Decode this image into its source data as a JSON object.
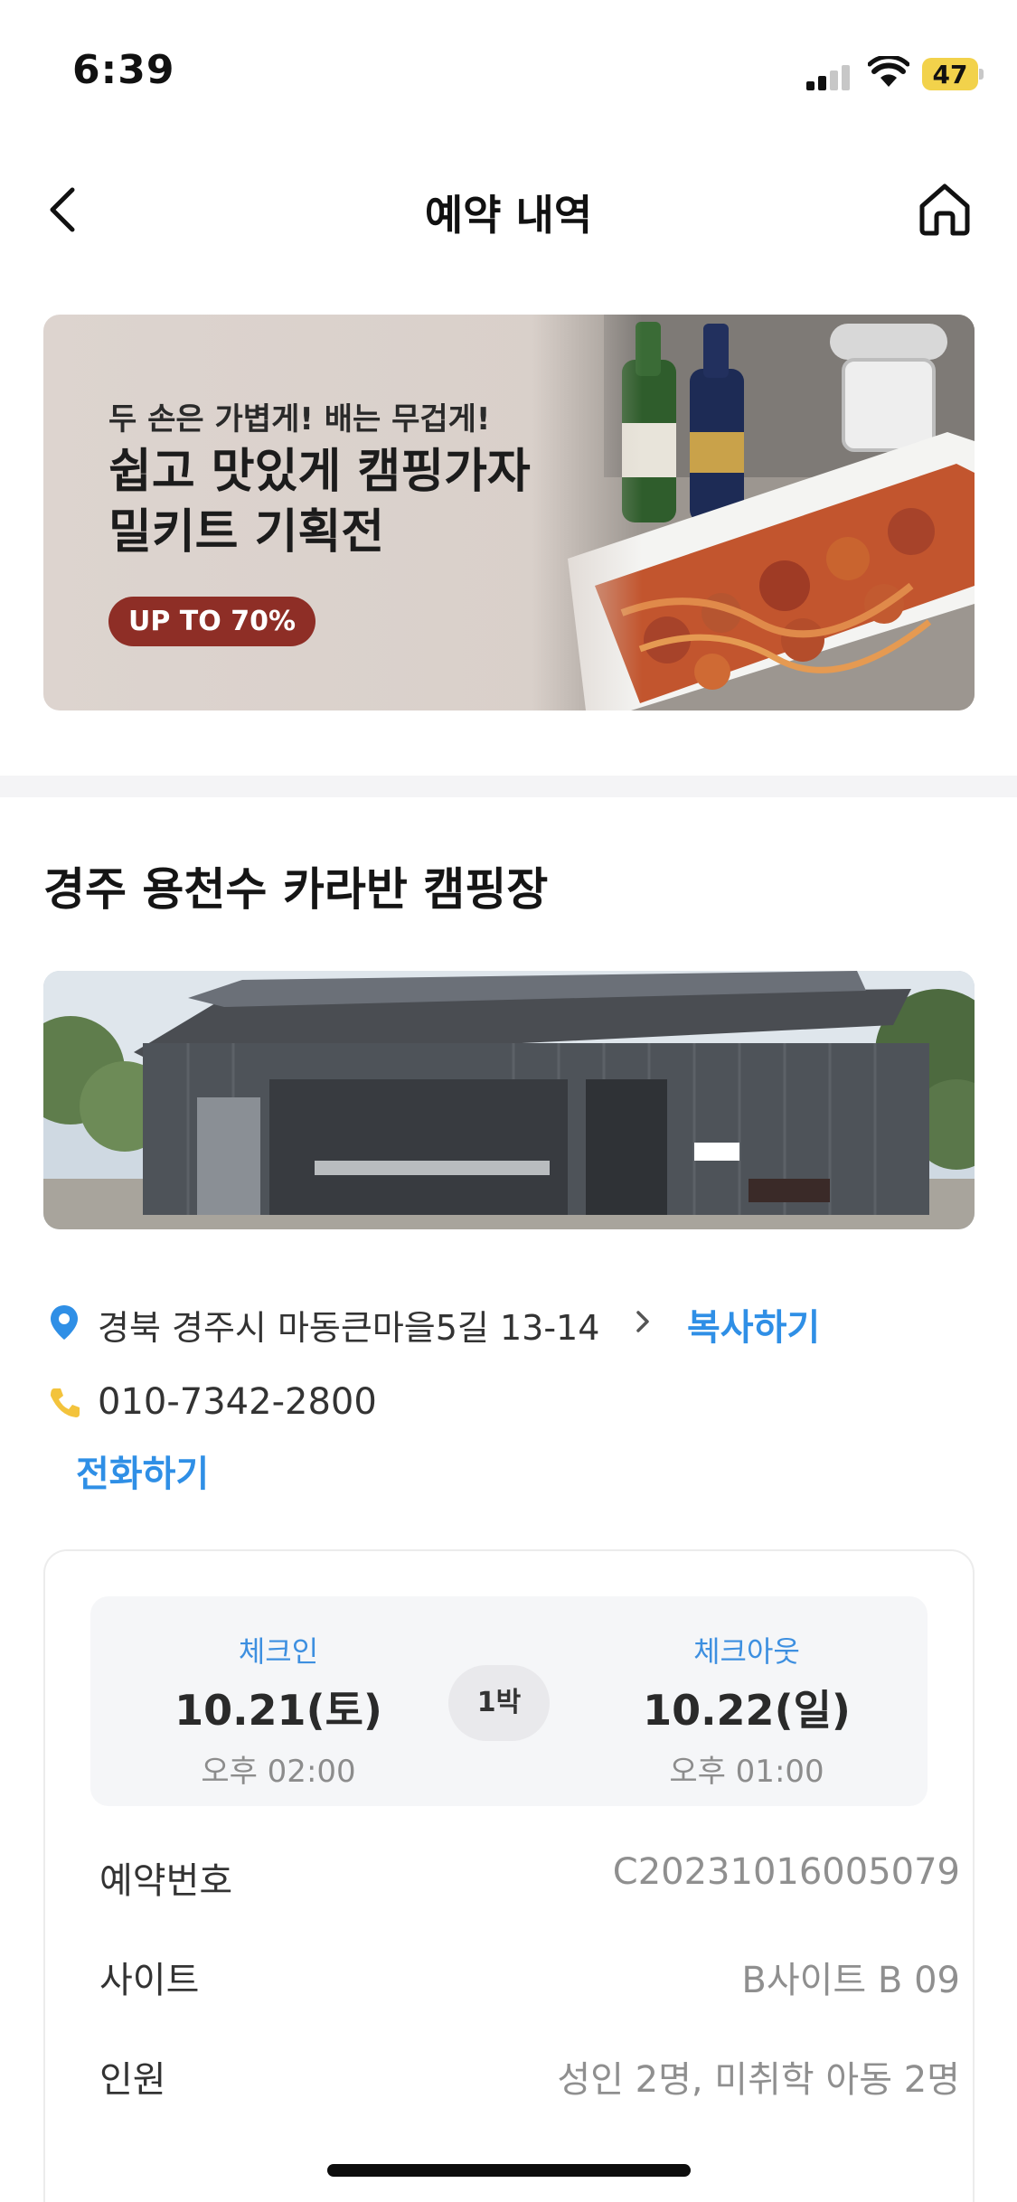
{
  "status_bar": {
    "time": "6:39",
    "battery_level": "47",
    "battery_color": "#f2d24b"
  },
  "nav": {
    "title": "예약 내역",
    "back_icon": "chevron-left-icon",
    "home_icon": "home-icon"
  },
  "banner": {
    "subtitle": "두 손은 가볍게! 배는 무겁게!",
    "title_line1": "쉽고 맛있게 캠핑가자",
    "title_line2": "밀키트 기획전",
    "badge": "UP TO 70%",
    "badge_color": "#8e2e26"
  },
  "campsite": {
    "name": "경주 용천수 카라반 캠핑장",
    "address": "경북 경주시 마동큰마을5길 13-14",
    "copy_label": "복사하기",
    "phone": "010-7342-2800",
    "call_label": "전화하기",
    "link_color": "#2f8fe6"
  },
  "reservation": {
    "checkin": {
      "label": "체크인",
      "date": "10.21(토)",
      "time": "오후 02:00"
    },
    "nights": "1박",
    "checkout": {
      "label": "체크아웃",
      "date": "10.22(일)",
      "time": "오후 01:00"
    },
    "rows": [
      {
        "label": "예약번호",
        "value": "C20231016005079"
      },
      {
        "label": "사이트",
        "value": "B사이트 B 09"
      },
      {
        "label": "인원",
        "value": "성인 2명, 미취학 아동 2명"
      }
    ]
  }
}
